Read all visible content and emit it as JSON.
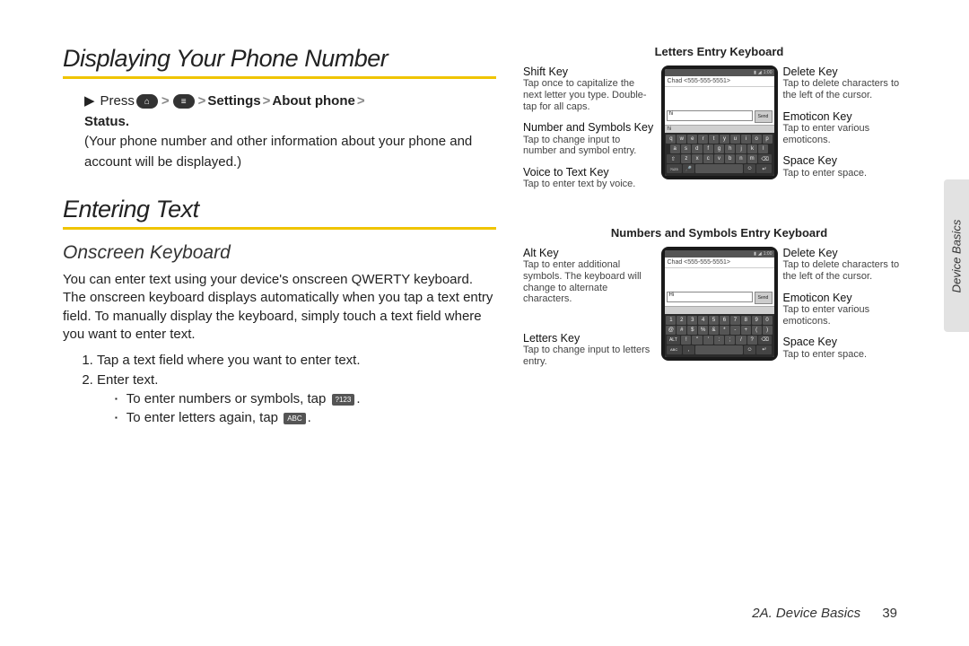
{
  "side_tab": "Device Basics",
  "footer": {
    "section": "2A. Device Basics",
    "page": "39"
  },
  "left": {
    "h1a": "Displaying Your Phone Number",
    "press": "Press",
    "sep": ">",
    "settings": "Settings",
    "about": "About phone",
    "status": "Status.",
    "status_tail": " (Your phone number and other information about your phone and account will be displayed.)",
    "h1b": "Entering Text",
    "h2": "Onscreen Keyboard",
    "para": "You can enter text using your device's onscreen QWERTY keyboard. The onscreen keyboard displays automatically when you tap a text entry field. To manually display the keyboard, simply touch a text field where you want to enter text.",
    "step1": "Tap a text field where you want to enter text.",
    "step2": "Enter text.",
    "bullet1a": "To enter numbers or symbols, tap ",
    "bullet1b": ".",
    "bullet2a": "To enter letters again, tap ",
    "bullet2b": ".",
    "key_num": "?123",
    "key_abc": "ABC"
  },
  "right": {
    "d1": {
      "title": "Letters Entry Keyboard",
      "left": [
        {
          "lbl": "Shift Key",
          "desc": "Tap once to capitalize the next letter you type. Double-tap for all caps."
        },
        {
          "lbl": "Number and Symbols Key",
          "desc": "Tap to change input to number and symbol entry."
        },
        {
          "lbl": "Voice to Text Key",
          "desc": "Tap to enter text by voice."
        }
      ],
      "right": [
        {
          "lbl": "Delete Key",
          "desc": "Tap to delete characters to the left of the cursor."
        },
        {
          "lbl": "Emoticon Key",
          "desc": "Tap to enter various emoticons."
        },
        {
          "lbl": "Space Key",
          "desc": "Tap to enter space."
        }
      ],
      "phone": {
        "to": "Chad <555-555-5551>",
        "input": "hi",
        "suggest": "hi"
      }
    },
    "d2": {
      "title": "Numbers and Symbols Entry Keyboard",
      "left": [
        {
          "lbl": "Alt Key",
          "desc": "Tap to enter additional symbols. The keyboard will change to alternate characters."
        },
        {
          "lbl": "Letters Key",
          "desc": "Tap to change input to letters entry."
        }
      ],
      "right": [
        {
          "lbl": "Delete Key",
          "desc": "Tap to delete characters to the left of the cursor."
        },
        {
          "lbl": "Emoticon Key",
          "desc": "Tap to enter various emoticons."
        },
        {
          "lbl": "Space Key",
          "desc": "Tap to enter space."
        }
      ],
      "phone": {
        "to": "Chad <555-555-5551>",
        "input": "Hi",
        "suggest": ""
      }
    }
  }
}
